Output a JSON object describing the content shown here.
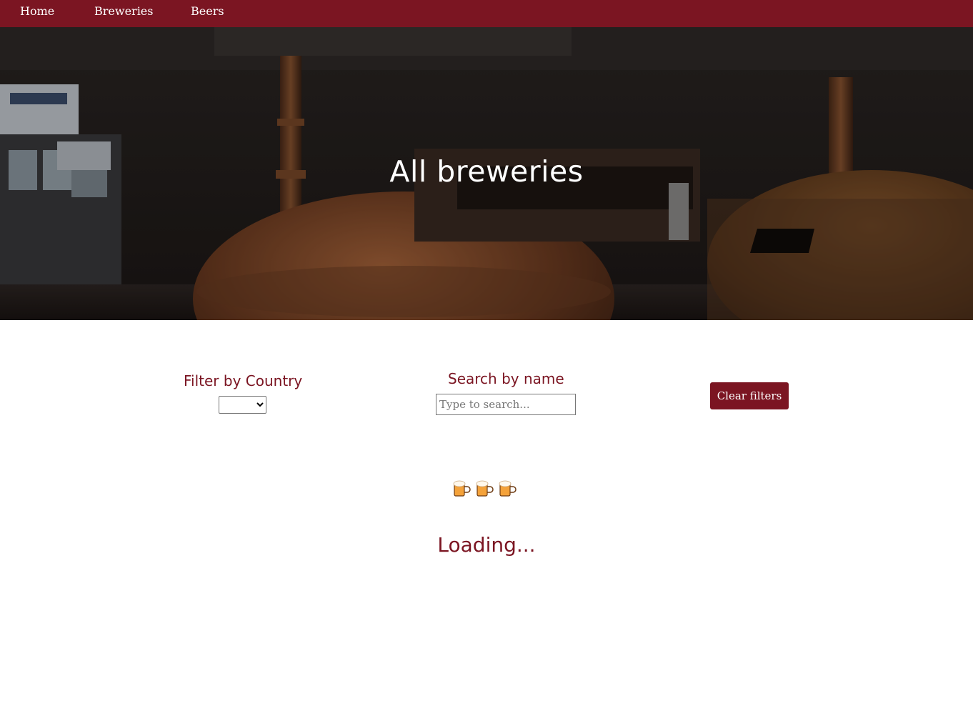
{
  "nav": {
    "items": [
      {
        "label": "Home"
      },
      {
        "label": "Breweries"
      },
      {
        "label": "Beers"
      }
    ]
  },
  "hero": {
    "title": "All breweries",
    "background": "brewery-copper-kettles-photo"
  },
  "filters": {
    "country_label": "Filter by Country",
    "country_selected": "",
    "search_label": "Search by name",
    "search_placeholder": "Type to search...",
    "search_value": "",
    "clear_label": "Clear filters"
  },
  "loading": {
    "icon": "beer-mugs-icon",
    "text": "Loading..."
  },
  "colors": {
    "brand": "#7b1522",
    "text_on_brand": "#ffffff"
  }
}
